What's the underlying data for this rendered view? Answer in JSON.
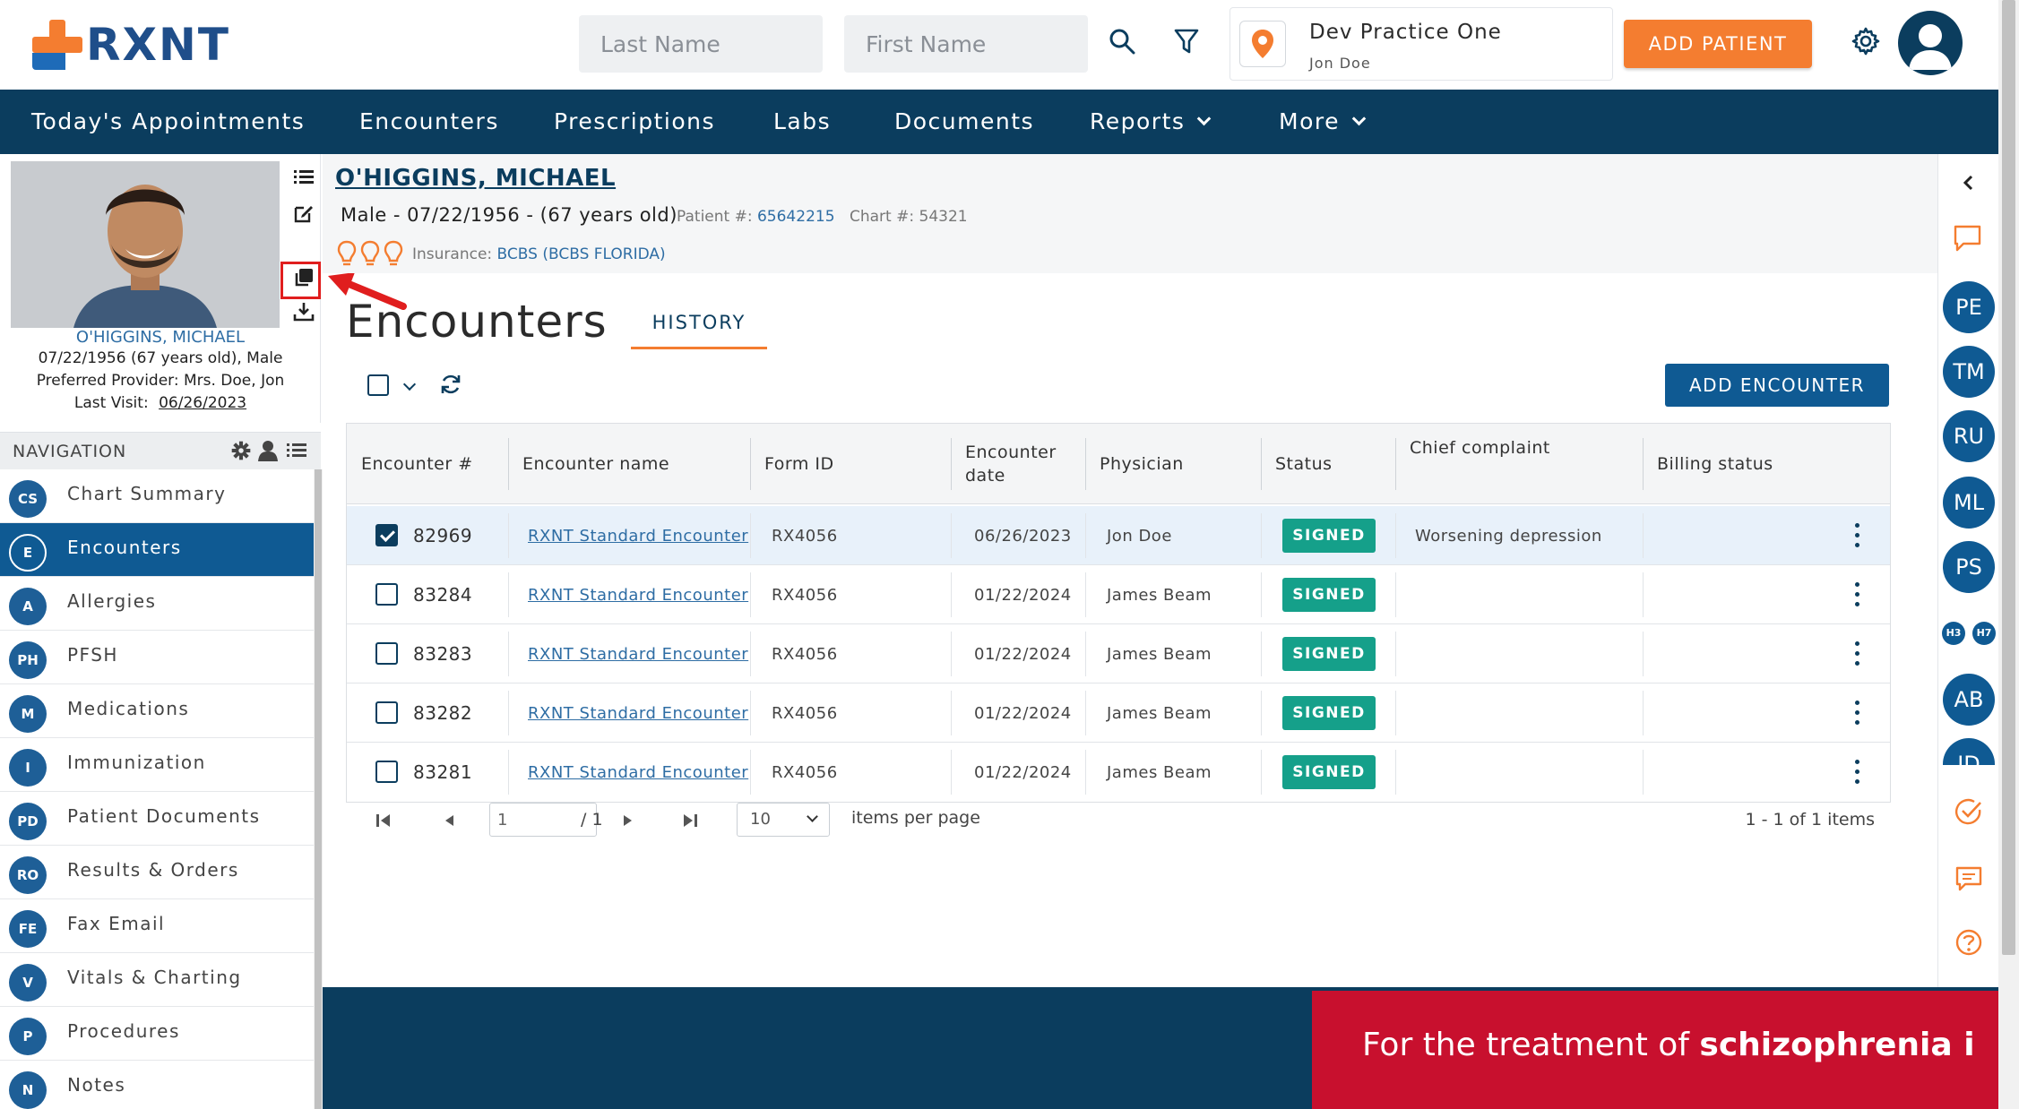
{
  "header": {
    "logo_text": "RXNT",
    "last_name_placeholder": "Last Name",
    "first_name_placeholder": "First Name",
    "practice_name": "Dev Practice One",
    "practice_user": "Jon Doe",
    "add_patient_label": "ADD PATIENT"
  },
  "main_nav": [
    {
      "label": "Today's Appointments",
      "dropdown": false
    },
    {
      "label": "Encounters",
      "dropdown": false
    },
    {
      "label": "Prescriptions",
      "dropdown": false
    },
    {
      "label": "Labs",
      "dropdown": false
    },
    {
      "label": "Documents",
      "dropdown": false
    },
    {
      "label": "Reports",
      "dropdown": true
    },
    {
      "label": "More",
      "dropdown": true
    }
  ],
  "patient_card": {
    "name": "O'HIGGINS, MICHAEL",
    "dob_line": "07/22/1956 (67 years old), Male",
    "provider_line": "Preferred Provider: Mrs. Doe, Jon",
    "last_visit_label": "Last Visit:",
    "last_visit_value": "06/26/2023"
  },
  "navigation": {
    "title": "NAVIGATION",
    "items": [
      {
        "abbr": "CS",
        "label": "Chart Summary",
        "active": false
      },
      {
        "abbr": "E",
        "label": "Encounters",
        "active": true
      },
      {
        "abbr": "A",
        "label": "Allergies",
        "active": false
      },
      {
        "abbr": "PH",
        "label": "PFSH",
        "active": false
      },
      {
        "abbr": "M",
        "label": "Medications",
        "active": false
      },
      {
        "abbr": "I",
        "label": "Immunization",
        "active": false
      },
      {
        "abbr": "PD",
        "label": "Patient Documents",
        "active": false
      },
      {
        "abbr": "RO",
        "label": "Results & Orders",
        "active": false
      },
      {
        "abbr": "FE",
        "label": "Fax Email",
        "active": false
      },
      {
        "abbr": "V",
        "label": "Vitals & Charting",
        "active": false
      },
      {
        "abbr": "P",
        "label": "Procedures",
        "active": false
      },
      {
        "abbr": "N",
        "label": "Notes",
        "active": false
      }
    ]
  },
  "patient_header": {
    "name": "O'HIGGINS, MICHAEL",
    "demographics": "Male - 07/22/1956 - (67 years old)",
    "patient_num_label": "Patient #:",
    "patient_num_value": "65642215",
    "chart_num_label": "Chart #:",
    "chart_num_value": "54321",
    "insurance_label": "Insurance:",
    "insurance_value": "BCBS (BCBS FLORIDA)"
  },
  "encounters": {
    "title": "Encounters",
    "history_tab": "HISTORY",
    "add_button": "ADD ENCOUNTER",
    "columns": [
      "Encounter #",
      "Encounter name",
      "Form ID",
      "Encounter date",
      "Physician",
      "Status",
      "Chief complaint",
      "Billing status"
    ],
    "rows": [
      {
        "num": "82969",
        "name": "RXNT Standard Encounter",
        "form_id": "RX4056",
        "date": "06/26/2023",
        "physician": "Jon Doe",
        "status": "SIGNED",
        "complaint": "Worsening depression",
        "billing": "",
        "checked": true
      },
      {
        "num": "83284",
        "name": "RXNT Standard Encounter",
        "form_id": "RX4056",
        "date": "01/22/2024",
        "physician": "James Beam",
        "status": "SIGNED",
        "complaint": "",
        "billing": "",
        "checked": false
      },
      {
        "num": "83283",
        "name": "RXNT Standard Encounter",
        "form_id": "RX4056",
        "date": "01/22/2024",
        "physician": "James Beam",
        "status": "SIGNED",
        "complaint": "",
        "billing": "",
        "checked": false
      },
      {
        "num": "83282",
        "name": "RXNT Standard Encounter",
        "form_id": "RX4056",
        "date": "01/22/2024",
        "physician": "James Beam",
        "status": "SIGNED",
        "complaint": "",
        "billing": "",
        "checked": false
      },
      {
        "num": "83281",
        "name": "RXNT Standard Encounter",
        "form_id": "RX4056",
        "date": "01/22/2024",
        "physician": "James Beam",
        "status": "SIGNED",
        "complaint": "",
        "billing": "",
        "checked": false
      }
    ],
    "pager": {
      "page_value": "1",
      "page_total": "/ 1",
      "per_page_value": "10",
      "per_page_label": "items per page",
      "count_text": "1 - 1 of 1 items"
    }
  },
  "right_rail": {
    "bubbles": [
      "PE",
      "TM",
      "RU",
      "ML",
      "PS"
    ],
    "small_bubbles": [
      "H3",
      "H7"
    ],
    "bubbles_lower": [
      "AB",
      "ID"
    ]
  },
  "banner": {
    "text_prefix": "For the treatment of ",
    "text_bold": "schizophrenia i"
  },
  "colors": {
    "brand_navy": "#0b3d5e",
    "brand_orange": "#f47d30",
    "link_blue": "#2e6da4",
    "signed_green": "#15a08a",
    "banner_red": "#c8102e"
  }
}
